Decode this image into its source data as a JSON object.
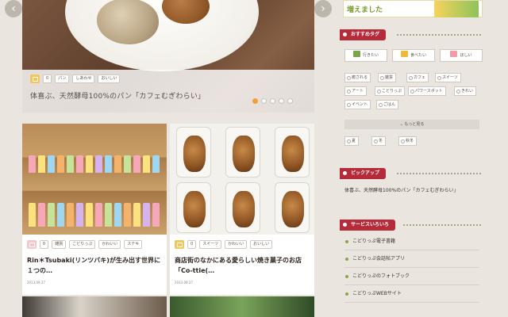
{
  "nav": {
    "prev_label": "‹",
    "next_label": "›"
  },
  "hero": {
    "likes": "0",
    "tags": [
      "パン",
      "しあわせ",
      "おいしい"
    ],
    "title": "体喜ぶ、天然酵母100%のパン「カフェむぎわらい」",
    "dots": 5
  },
  "cards": [
    {
      "likes": "0",
      "tags": [
        "雑貨",
        "こどりっぷ",
        "かわいい",
        "ステキ"
      ],
      "title": "Rin＊Tsubaki(リンツバキ)が生み出す世界に１つの…",
      "date": "2013.09.27"
    },
    {
      "likes": "0",
      "tags": [
        "スイーツ",
        "かわいい",
        "おいしい"
      ],
      "title": "商店街のなかにある愛らしい焼き菓子のお店「Co-ttie(…",
      "date": "2013.09.27"
    }
  ],
  "sidebar": {
    "banner": "増えました",
    "recommended_tag_title": "おすすめタグ",
    "mood_buttons": [
      {
        "label": "行きたい",
        "color": "#7aa64a"
      },
      {
        "label": "食べたい",
        "color": "#f0b93c"
      },
      {
        "label": "ほしい",
        "color": "#f39aa8"
      }
    ],
    "tags": [
      "癒される",
      "雑貨",
      "カフェ",
      "スイーツ",
      "アート",
      "こどりっぷ",
      "パワースポット",
      "きれい",
      "イベント",
      "ごはん"
    ],
    "more_label": "もっと見る",
    "season_tags": [
      "夏",
      "冬",
      "秋冬"
    ],
    "pickup_title": "ピックアップ",
    "pickup_item": "体喜ぶ、天然酵母100%のパン「カフェむぎわらい」",
    "service_title": "サービスいろいろ",
    "services": [
      "こどりっぷ電子書籍",
      "こどりっぷ会話帖アプリ",
      "こどりっぷのフォトブック",
      "こどりっぷWEBサイト"
    ]
  }
}
